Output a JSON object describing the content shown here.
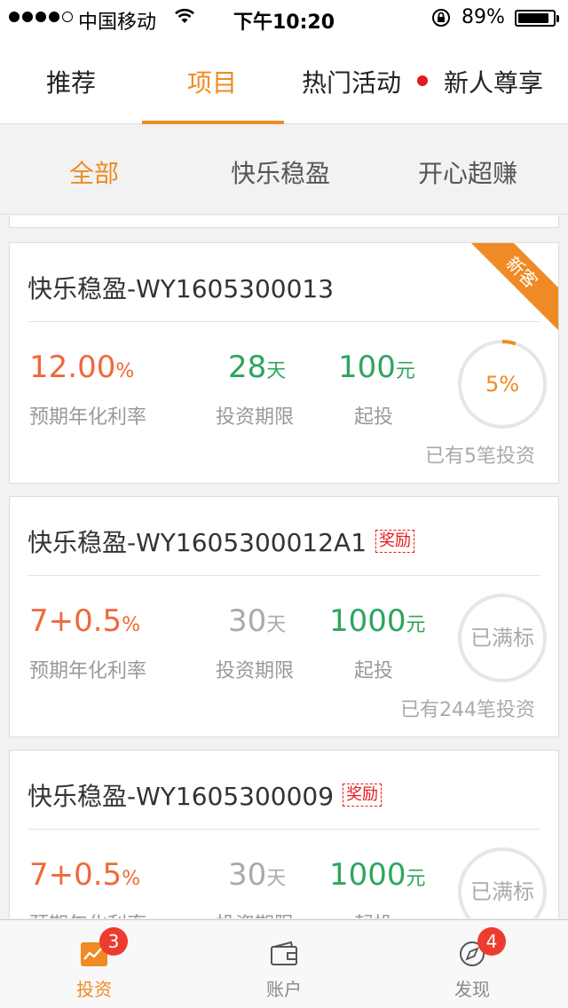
{
  "status_bar": {
    "carrier": "中国移动",
    "time": "下午10:20",
    "battery": "89%",
    "battery_level": 0.89
  },
  "top_tabs": [
    {
      "label": "推荐",
      "active": false
    },
    {
      "label": "项目",
      "active": true
    },
    {
      "label": "热门活动",
      "active": false,
      "has_dot": true
    },
    {
      "label": "新人尊享",
      "active": false
    }
  ],
  "sub_tabs": [
    {
      "label": "全部",
      "active": true
    },
    {
      "label": "快乐稳盈",
      "active": false
    },
    {
      "label": "开心超赚",
      "active": false
    }
  ],
  "cards": [
    {
      "title": "快乐稳盈-WY1605300013",
      "corner_tag": "新客",
      "rate": "12.00",
      "rate_unit": "%",
      "rate_label": "预期年化利率",
      "term": "28",
      "term_unit": "天",
      "term_label": "投资期限",
      "min": "100",
      "min_unit": "元",
      "min_label": "起投",
      "progress_text": "5%",
      "progress": 0.05,
      "count": "已有5笔投资"
    },
    {
      "title": "快乐稳盈-WY1605300012A1",
      "badge": "奖励",
      "rate": "7+0.5",
      "rate_unit": "%",
      "rate_label": "预期年化利率",
      "term": "30",
      "term_unit": "天",
      "term_label": "投资期限",
      "min": "1000",
      "min_unit": "元",
      "min_label": "起投",
      "progress_text": "已满标",
      "count": "已有244笔投资"
    },
    {
      "title": "快乐稳盈-WY1605300009",
      "badge": "奖励",
      "rate": "7+0.5",
      "rate_unit": "%",
      "rate_label": "预期年化利率",
      "term": "30",
      "term_unit": "天",
      "term_label": "投资期限",
      "min": "1000",
      "min_unit": "元",
      "min_label": "起投",
      "progress_text": "已满标"
    }
  ],
  "bottom_tabs": [
    {
      "label": "投资",
      "icon": "chart-icon",
      "badge": "3",
      "active": true
    },
    {
      "label": "账户",
      "icon": "wallet-icon",
      "active": false
    },
    {
      "label": "发现",
      "icon": "compass-icon",
      "badge": "4",
      "active": false
    }
  ],
  "colors": {
    "accent": "#f08a24",
    "rate": "#f0683a",
    "green": "#2da55d",
    "badge_red": "#e8191b"
  }
}
